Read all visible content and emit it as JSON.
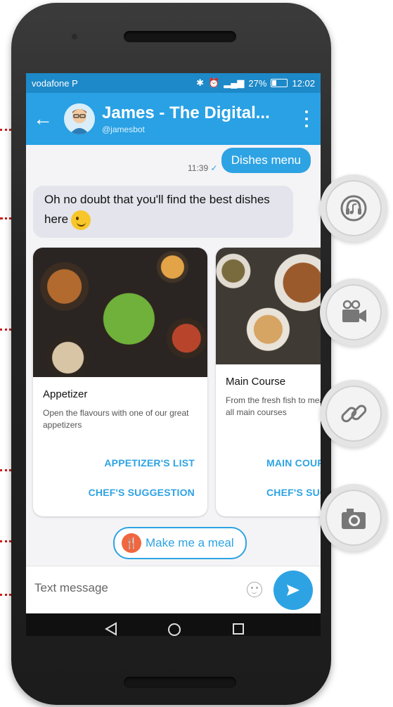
{
  "status_bar": {
    "carrier": "vodafone P",
    "battery": "27%",
    "time": "12:02"
  },
  "header": {
    "title": "James - The Digital...",
    "subtitle": "@jamesbot",
    "back_icon": "arrow-left-icon",
    "menu_icon": "more-vert-icon"
  },
  "chat": {
    "outgoing": {
      "text": "Dishes menu",
      "time": "11:39",
      "status": "✓"
    },
    "incoming": {
      "text": "Oh no doubt that you'll find the best dishes here"
    }
  },
  "carousel": [
    {
      "title": "Appetizer",
      "description": "Open the flavours with one of our great appetizers",
      "buttons": [
        "APPETIZER'S LIST",
        "CHEF'S SUGGESTION"
      ]
    },
    {
      "title": "Main Course",
      "description": "From the fresh fish to meat try our great all main courses",
      "buttons": [
        "MAIN COURSES",
        "CHEF'S SUGGESTION"
      ]
    }
  ],
  "quick_reply": {
    "label": "Make me a meal"
  },
  "composer": {
    "placeholder": "Text message",
    "send_icon": "send-icon",
    "emoji_icon": "emoji-icon"
  },
  "features": [
    "audio-icon",
    "video-icon",
    "link-icon",
    "camera-icon"
  ],
  "colors": {
    "status_bar": "#1d89c8",
    "app_bar": "#29a1e4",
    "accent": "#2ea3e3",
    "annotation": "#e60f0f"
  }
}
